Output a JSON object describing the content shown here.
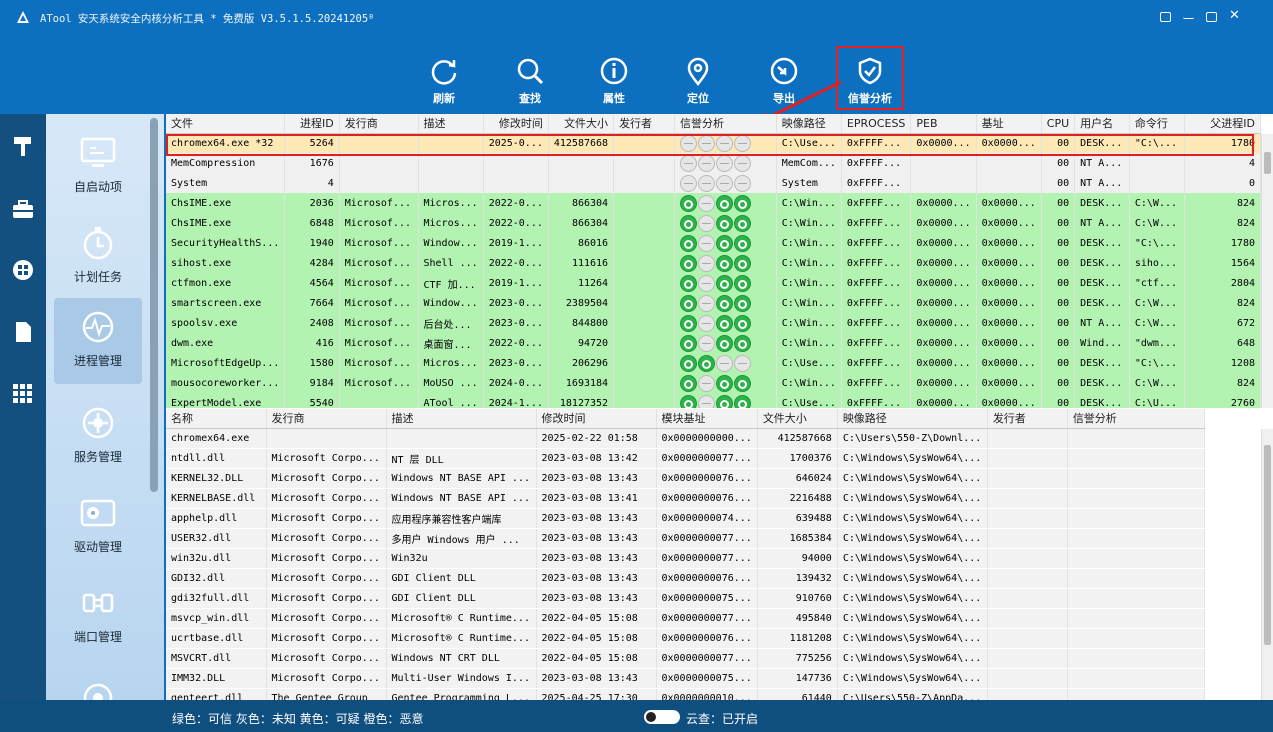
{
  "title": "ATool 安天系统安全内核分析工具 * 免费版 V3.5.1.5.20241205ᴮ",
  "toolbar": [
    {
      "label": "刷新"
    },
    {
      "label": "查找"
    },
    {
      "label": "属性"
    },
    {
      "label": "定位"
    },
    {
      "label": "导出"
    },
    {
      "label": "信誉分析"
    }
  ],
  "nav": [
    {
      "label": "自启动项"
    },
    {
      "label": "计划任务"
    },
    {
      "label": "进程管理"
    },
    {
      "label": "服务管理"
    },
    {
      "label": "驱动管理"
    },
    {
      "label": "端口管理"
    }
  ],
  "proc_headers": [
    "文件",
    "进程ID",
    "发行商",
    "描述",
    "修改时间",
    "文件大小",
    "发行者",
    "信誉分析",
    "映像路径",
    "EPROCESS",
    "PEB",
    "基址",
    "CPU",
    "用户名",
    "命令行",
    "父进程ID"
  ],
  "processes": [
    {
      "s": "o",
      "r": "xxxx",
      "c": [
        "chromex64.exe *32",
        "5264",
        "",
        "",
        "2025-0...",
        "412587668",
        "",
        "",
        "C:\\Use...",
        "0xFFFF...",
        "0x0000...",
        "0x0000...",
        "00",
        "DESK...",
        "\"C:\\...",
        "1780"
      ]
    },
    {
      "s": "w",
      "r": "xxxx",
      "c": [
        "MemCompression",
        "1676",
        "",
        "",
        "",
        "",
        "",
        "",
        "MemCom...",
        "0xFFFF...",
        "",
        "",
        "00",
        "NT A...",
        "",
        "4"
      ]
    },
    {
      "s": "w",
      "r": "xxxx",
      "c": [
        "System",
        "4",
        "",
        "",
        "",
        "",
        "",
        "",
        "System",
        "0xFFFF...",
        "",
        "",
        "00",
        "NT A...",
        "",
        "0"
      ]
    },
    {
      "s": "g",
      "r": "txtt",
      "c": [
        "ChsIME.exe",
        "2036",
        "Microsof...",
        "Micros...",
        "2022-0...",
        "866304",
        "",
        "",
        "C:\\Win...",
        "0xFFFF...",
        "0x0000...",
        "0x0000...",
        "00",
        "DESK...",
        "C:\\W...",
        "824"
      ]
    },
    {
      "s": "g",
      "r": "txtt",
      "c": [
        "ChsIME.exe",
        "6848",
        "Microsof...",
        "Micros...",
        "2022-0...",
        "866304",
        "",
        "",
        "C:\\Win...",
        "0xFFFF...",
        "0x0000...",
        "0x0000...",
        "00",
        "NT A...",
        "C:\\W...",
        "824"
      ]
    },
    {
      "s": "g",
      "r": "txtt",
      "c": [
        "SecurityHealthS...",
        "1940",
        "Microsof...",
        "Window...",
        "2019-1...",
        "86016",
        "",
        "",
        "C:\\Win...",
        "0xFFFF...",
        "0x0000...",
        "0x0000...",
        "00",
        "DESK...",
        "\"C:\\...",
        "1780"
      ]
    },
    {
      "s": "g",
      "r": "txtt",
      "c": [
        "sihost.exe",
        "4284",
        "Microsof...",
        "Shell ...",
        "2022-0...",
        "111616",
        "",
        "",
        "C:\\Win...",
        "0xFFFF...",
        "0x0000...",
        "0x0000...",
        "00",
        "DESK...",
        "siho...",
        "1564"
      ]
    },
    {
      "s": "g",
      "r": "txtt",
      "c": [
        "ctfmon.exe",
        "4564",
        "Microsof...",
        "CTF 加...",
        "2019-1...",
        "11264",
        "",
        "",
        "C:\\Win...",
        "0xFFFF...",
        "0x0000...",
        "0x0000...",
        "00",
        "DESK...",
        "\"ctf...",
        "2804"
      ]
    },
    {
      "s": "g",
      "r": "txtt",
      "c": [
        "smartscreen.exe",
        "7664",
        "Microsof...",
        "Window...",
        "2023-0...",
        "2389504",
        "",
        "",
        "C:\\Win...",
        "0xFFFF...",
        "0x0000...",
        "0x0000...",
        "00",
        "DESK...",
        "C:\\W...",
        "824"
      ]
    },
    {
      "s": "g",
      "r": "txtt",
      "c": [
        "spoolsv.exe",
        "2408",
        "Microsof...",
        "后台处...",
        "2023-0...",
        "844800",
        "",
        "",
        "C:\\Win...",
        "0xFFFF...",
        "0x0000...",
        "0x0000...",
        "00",
        "NT A...",
        "C:\\W...",
        "672"
      ]
    },
    {
      "s": "g",
      "r": "txtt",
      "c": [
        "dwm.exe",
        "416",
        "Microsof...",
        "桌面窗...",
        "2022-0...",
        "94720",
        "",
        "",
        "C:\\Win...",
        "0xFFFF...",
        "0x0000...",
        "0x0000...",
        "00",
        "Wind...",
        "\"dwm...",
        "648"
      ]
    },
    {
      "s": "g",
      "r": "ttxx",
      "c": [
        "MicrosoftEdgeUp...",
        "1580",
        "Microsof...",
        "Micros...",
        "2023-0...",
        "206296",
        "",
        "",
        "C:\\Use...",
        "0xFFFF...",
        "0x0000...",
        "0x0000...",
        "00",
        "DESK...",
        "\"C:\\...",
        "1208"
      ]
    },
    {
      "s": "g",
      "r": "txtt",
      "c": [
        "mousocoreworker...",
        "9184",
        "Microsof...",
        "MoUSO ...",
        "2024-0...",
        "1693184",
        "",
        "",
        "C:\\Win...",
        "0xFFFF...",
        "0x0000...",
        "0x0000...",
        "00",
        "DESK...",
        "C:\\W...",
        "824"
      ]
    },
    {
      "s": "g",
      "r": "txtt",
      "c": [
        "ExpertModel.exe",
        "5540",
        "",
        "ATool ...",
        "2024-1...",
        "18127352",
        "",
        "",
        "C:\\Use...",
        "0xFFFF...",
        "0x0000...",
        "0x0000...",
        "00",
        "DESK...",
        "C:\\U...",
        "2760"
      ]
    }
  ],
  "mod_headers": [
    "名称",
    "发行商",
    "描述",
    "修改时间",
    "模块基址",
    "文件大小",
    "映像路径",
    "发行者",
    "信誉分析"
  ],
  "modules": [
    [
      "chromex64.exe",
      "",
      "",
      "2025-02-22 01:58",
      "0x0000000000...",
      "412587668",
      "C:\\Users\\550-Z\\Downl...",
      "",
      ""
    ],
    [
      "ntdll.dll",
      "Microsoft Corpo...",
      "NT 层 DLL",
      "2023-03-08 13:42",
      "0x0000000077...",
      "1700376",
      "C:\\Windows\\SysWow64\\...",
      "",
      ""
    ],
    [
      "KERNEL32.DLL",
      "Microsoft Corpo...",
      "Windows NT BASE API ...",
      "2023-03-08 13:43",
      "0x0000000076...",
      "646024",
      "C:\\Windows\\SysWow64\\...",
      "",
      ""
    ],
    [
      "KERNELBASE.dll",
      "Microsoft Corpo...",
      "Windows NT BASE API ...",
      "2023-03-08 13:41",
      "0x0000000076...",
      "2216488",
      "C:\\Windows\\SysWow64\\...",
      "",
      ""
    ],
    [
      "apphelp.dll",
      "Microsoft Corpo...",
      "应用程序兼容性客户端库",
      "2023-03-08 13:43",
      "0x0000000074...",
      "639488",
      "C:\\Windows\\SysWow64\\...",
      "",
      ""
    ],
    [
      "USER32.dll",
      "Microsoft Corpo...",
      "多用户 Windows 用户 ...",
      "2023-03-08 13:43",
      "0x0000000077...",
      "1685384",
      "C:\\Windows\\SysWow64\\...",
      "",
      ""
    ],
    [
      "win32u.dll",
      "Microsoft Corpo...",
      "Win32u",
      "2023-03-08 13:43",
      "0x0000000077...",
      "94000",
      "C:\\Windows\\SysWow64\\...",
      "",
      ""
    ],
    [
      "GDI32.dll",
      "Microsoft Corpo...",
      "GDI Client DLL",
      "2023-03-08 13:43",
      "0x0000000076...",
      "139432",
      "C:\\Windows\\SysWow64\\...",
      "",
      ""
    ],
    [
      "gdi32full.dll",
      "Microsoft Corpo...",
      "GDI Client DLL",
      "2023-03-08 13:43",
      "0x0000000075...",
      "910760",
      "C:\\Windows\\SysWow64\\...",
      "",
      ""
    ],
    [
      "msvcp_win.dll",
      "Microsoft Corpo...",
      "Microsoft® C Runtime...",
      "2022-04-05 15:08",
      "0x0000000077...",
      "495840",
      "C:\\Windows\\SysWow64\\...",
      "",
      ""
    ],
    [
      "ucrtbase.dll",
      "Microsoft Corpo...",
      "Microsoft® C Runtime...",
      "2022-04-05 15:08",
      "0x0000000076...",
      "1181208",
      "C:\\Windows\\SysWow64\\...",
      "",
      ""
    ],
    [
      "MSVCRT.dll",
      "Microsoft Corpo...",
      "Windows NT CRT DLL",
      "2022-04-05 15:08",
      "0x0000000077...",
      "775256",
      "C:\\Windows\\SysWow64\\...",
      "",
      ""
    ],
    [
      "IMM32.DLL",
      "Microsoft Corpo...",
      "Multi-User Windows I...",
      "2023-03-08 13:43",
      "0x0000000075...",
      "147736",
      "C:\\Windows\\SysWow64\\...",
      "",
      ""
    ],
    [
      "genteert.dll",
      "The Gentee Group",
      "Gentee Programming L...",
      "2025-04-25 17:30",
      "0x0000000010...",
      "61440",
      "C:\\Users\\550-Z\\AppDa...",
      "",
      ""
    ]
  ],
  "status": {
    "legend": "绿色：可信  灰色：未知  黄色：可疑  橙色：恶意",
    "cloud": "云查：已开启"
  }
}
